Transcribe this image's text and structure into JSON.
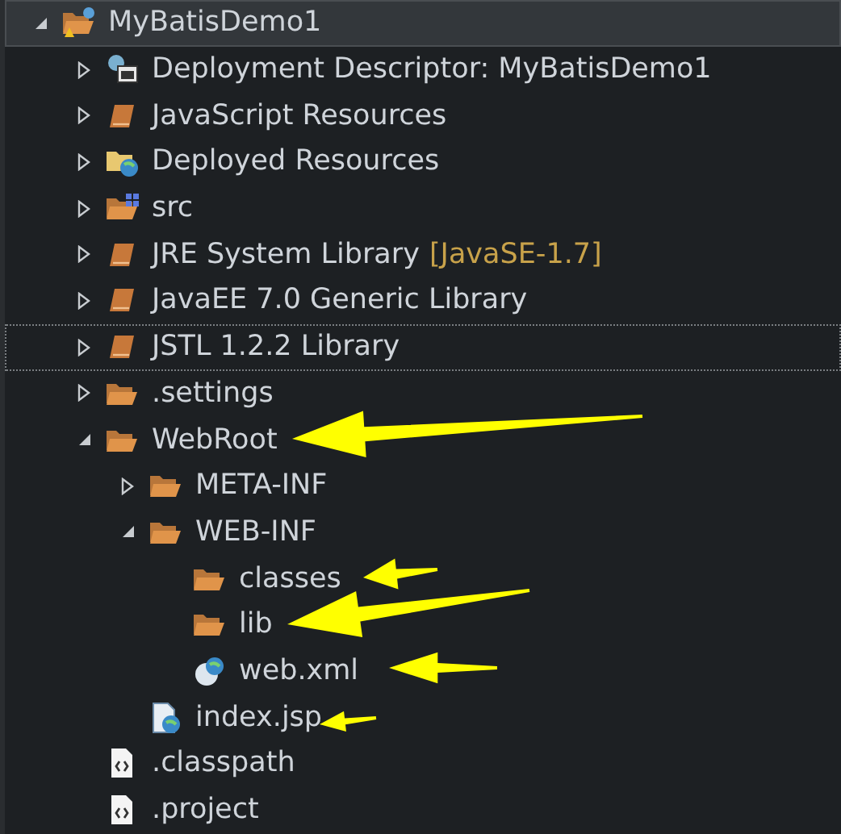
{
  "tree": [
    {
      "label": "MyBatisDemo1",
      "kind": "project",
      "expanded": true,
      "selected": true,
      "focused": false,
      "children": [
        {
          "label": "Deployment Descriptor: MyBatisDemo1",
          "kind": "descriptor",
          "expanded": false,
          "selected": false,
          "focused": false
        },
        {
          "label": "JavaScript Resources",
          "kind": "library",
          "expanded": false,
          "selected": false,
          "focused": false
        },
        {
          "label": "Deployed Resources",
          "kind": "deployed",
          "expanded": false,
          "selected": false,
          "focused": false
        },
        {
          "label": "src",
          "kind": "source",
          "expanded": false,
          "selected": false,
          "focused": false
        },
        {
          "label": "JRE System Library",
          "decoration": "[JavaSE-1.7]",
          "kind": "library",
          "expanded": false,
          "selected": false,
          "focused": false
        },
        {
          "label": "JavaEE 7.0 Generic Library",
          "kind": "library",
          "expanded": false,
          "selected": false,
          "focused": false
        },
        {
          "label": "JSTL 1.2.2 Library",
          "kind": "library",
          "expanded": false,
          "selected": false,
          "focused": true
        },
        {
          "label": ".settings",
          "kind": "folder",
          "expanded": false,
          "selected": false,
          "focused": false
        },
        {
          "label": "WebRoot",
          "kind": "folder",
          "expanded": true,
          "selected": false,
          "focused": false,
          "children": [
            {
              "label": "META-INF",
              "kind": "folder",
              "expanded": false,
              "selected": false,
              "focused": false
            },
            {
              "label": "WEB-INF",
              "kind": "folder",
              "expanded": true,
              "selected": false,
              "focused": false,
              "children": [
                {
                  "label": "classes",
                  "kind": "folder",
                  "selected": false,
                  "focused": false
                },
                {
                  "label": "lib",
                  "kind": "folder",
                  "selected": false,
                  "focused": false
                },
                {
                  "label": "web.xml",
                  "kind": "xml",
                  "selected": false,
                  "focused": false
                }
              ]
            },
            {
              "label": "index.jsp",
              "kind": "jsp",
              "selected": false,
              "focused": false
            }
          ]
        },
        {
          "label": ".classpath",
          "kind": "file",
          "selected": false,
          "focused": false
        },
        {
          "label": ".project",
          "kind": "file",
          "selected": false,
          "focused": false
        }
      ]
    }
  ]
}
